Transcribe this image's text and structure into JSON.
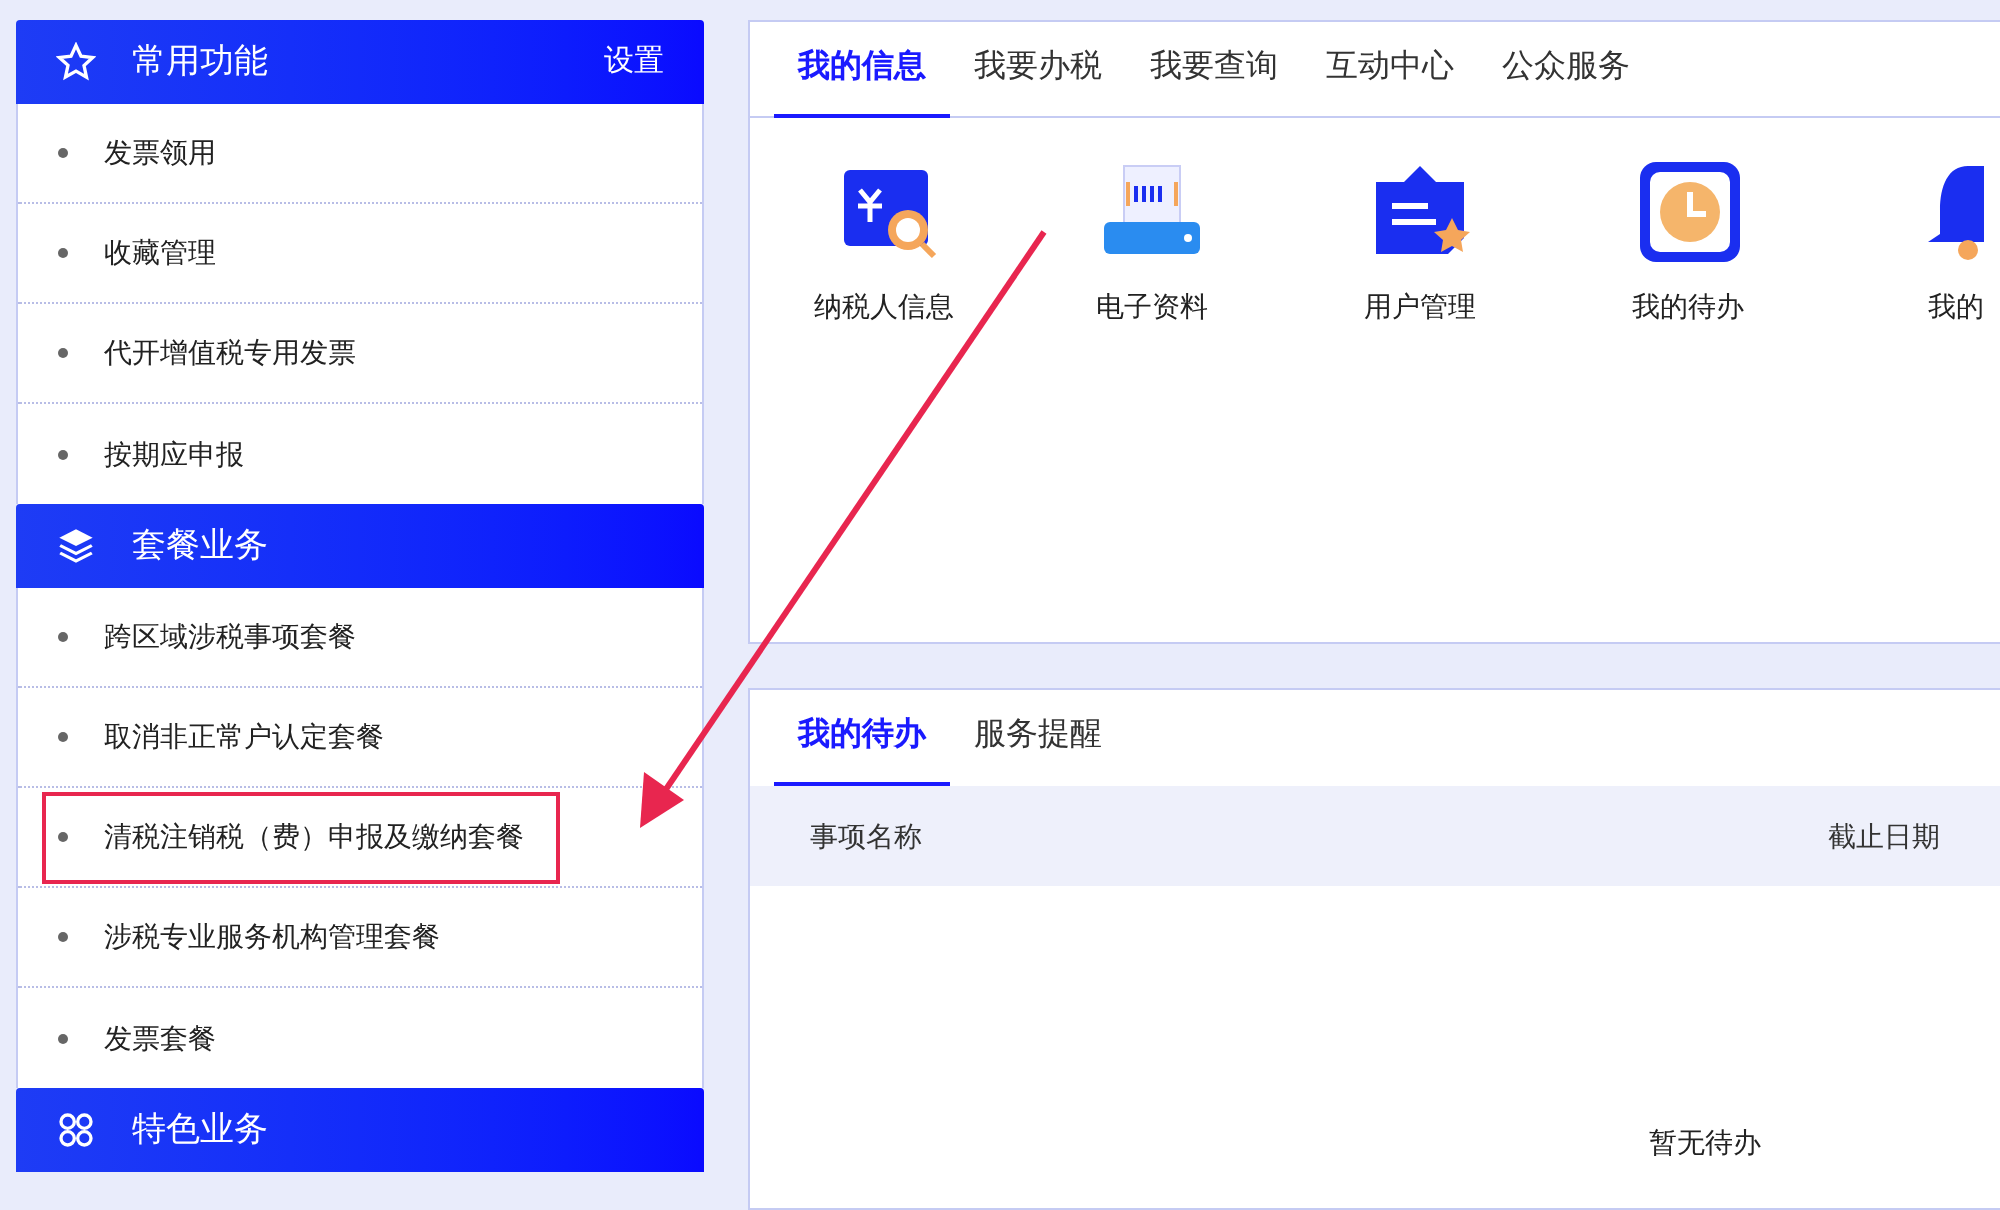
{
  "sidebar": {
    "sections": [
      {
        "title": "常用功能",
        "action": "设置",
        "items": [
          {
            "label": "发票领用",
            "highlighted": false
          },
          {
            "label": "收藏管理",
            "highlighted": false
          },
          {
            "label": "代开增值税专用发票",
            "highlighted": false
          },
          {
            "label": "按期应申报",
            "highlighted": false
          }
        ]
      },
      {
        "title": "套餐业务",
        "items": [
          {
            "label": "跨区域涉税事项套餐",
            "highlighted": false
          },
          {
            "label": "取消非正常户认定套餐",
            "highlighted": false
          },
          {
            "label": "清税注销税（费）申报及缴纳套餐",
            "highlighted": true
          },
          {
            "label": "涉税专业服务机构管理套餐",
            "highlighted": false
          },
          {
            "label": "发票套餐",
            "highlighted": false
          }
        ]
      },
      {
        "title": "特色业务"
      }
    ]
  },
  "info_panel": {
    "tabs": [
      {
        "label": "我的信息",
        "selected": true
      },
      {
        "label": "我要办税",
        "selected": false
      },
      {
        "label": "我要查询",
        "selected": false
      },
      {
        "label": "互动中心",
        "selected": false
      },
      {
        "label": "公众服务",
        "selected": false
      }
    ],
    "tiles": [
      {
        "kind": "receipt",
        "label": "纳税人信息"
      },
      {
        "kind": "printer",
        "label": "电子资料"
      },
      {
        "kind": "folder",
        "label": "用户管理"
      },
      {
        "kind": "clock",
        "label": "我的待办"
      },
      {
        "kind": "bell",
        "label": "我的"
      }
    ]
  },
  "todo_panel": {
    "tabs": [
      {
        "label": "我的待办",
        "selected": true
      },
      {
        "label": "服务提醒",
        "selected": false
      }
    ],
    "columns": [
      "事项名称",
      "截止日期"
    ],
    "empty_text": "暂无待办"
  }
}
